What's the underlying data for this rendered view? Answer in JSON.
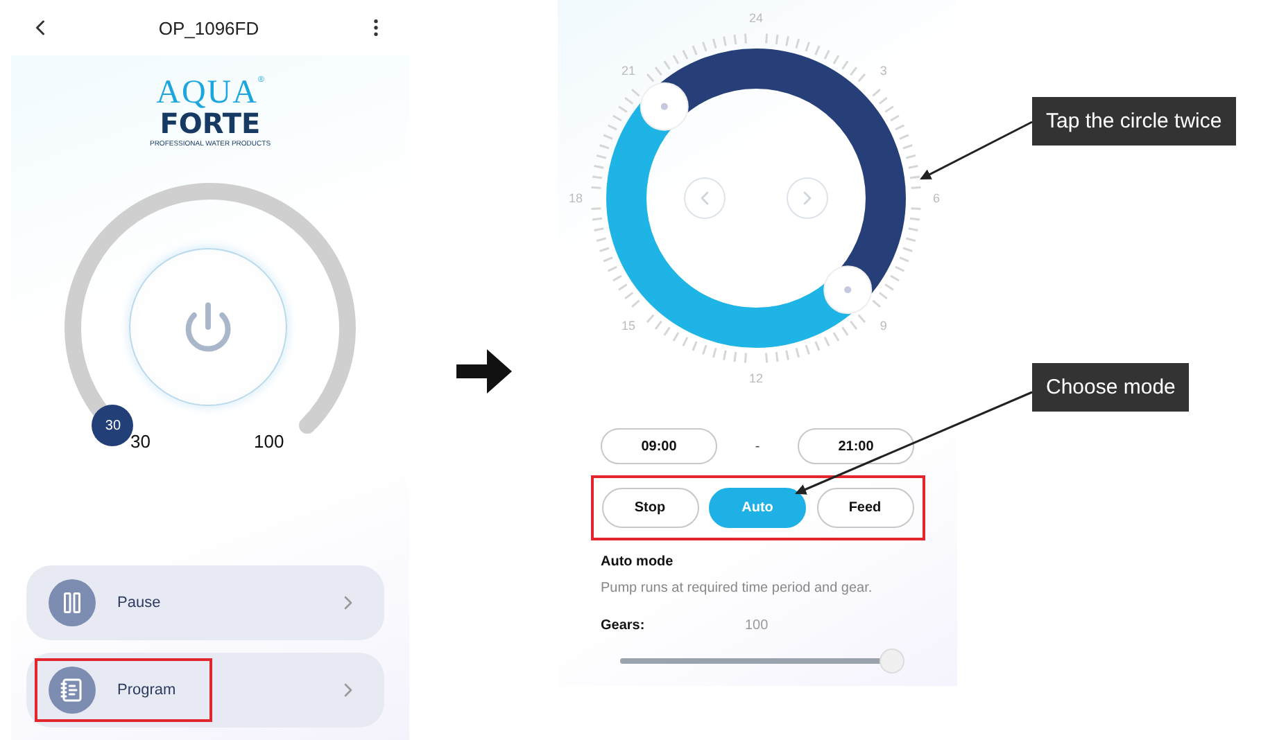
{
  "left_screen": {
    "header": {
      "title": "OP_1096FD"
    },
    "logo": {
      "line_1": "AQUA",
      "registered_mark": "®",
      "line_2": "FORTE",
      "tagline": "PROFESSIONAL WATER PRODUCTS"
    },
    "dial": {
      "thumb_value": "30",
      "min_label": "30",
      "max_label": "100"
    },
    "menu": [
      {
        "label": "Pause",
        "kind": "pause",
        "highlighted": false
      },
      {
        "label": "Program",
        "kind": "program",
        "highlighted": true
      }
    ]
  },
  "right_screen": {
    "clock": {
      "labels": [
        "24",
        "3",
        "6",
        "9",
        "12",
        "15",
        "18",
        "21"
      ]
    },
    "time_range": {
      "start": "09:00",
      "separator": "-",
      "end": "21:00"
    },
    "mode_selector": {
      "highlighted": true,
      "options": [
        {
          "label": "Stop",
          "selected": false
        },
        {
          "label": "Auto",
          "selected": true
        },
        {
          "label": "Feed",
          "selected": false
        }
      ]
    },
    "mode_title": "Auto mode",
    "mode_description": "Pump runs at required time period and gear.",
    "gears": {
      "label": "Gears:",
      "value": "100",
      "level": 1
    }
  },
  "callouts": [
    {
      "text": "Tap the circle twice"
    },
    {
      "text": "Choose mode"
    }
  ]
}
